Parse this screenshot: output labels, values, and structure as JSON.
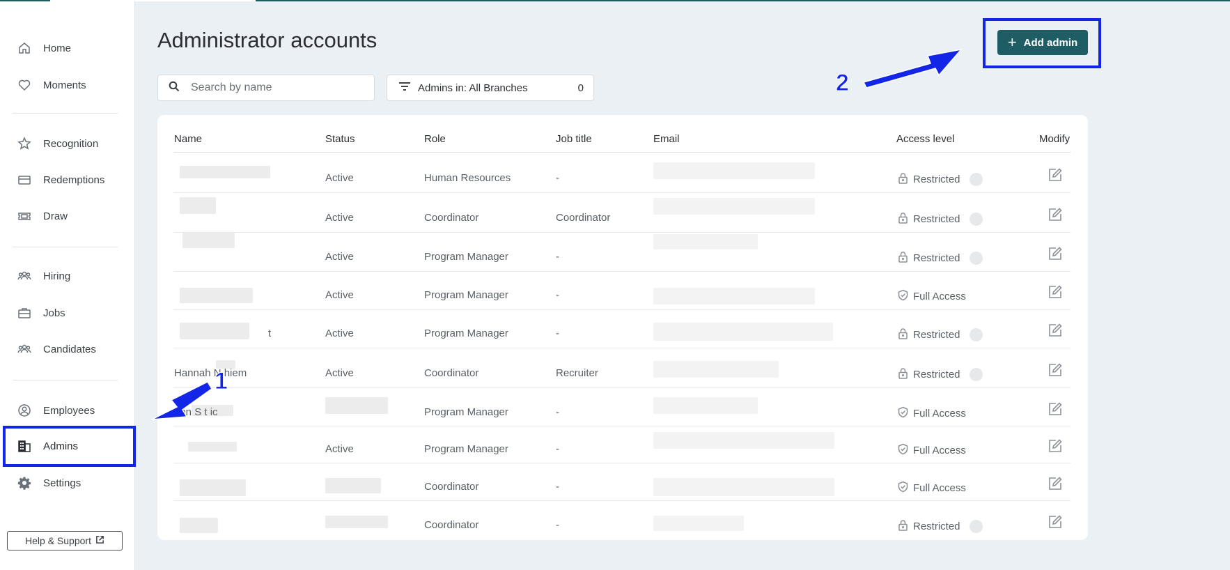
{
  "sidebar": {
    "items": [
      {
        "label": "Home",
        "icon": "home-icon"
      },
      {
        "label": "Moments",
        "icon": "heart-icon"
      },
      {
        "label": "Recognition",
        "icon": "star-icon"
      },
      {
        "label": "Redemptions",
        "icon": "card-icon"
      },
      {
        "label": "Draw",
        "icon": "ticket-icon"
      },
      {
        "label": "Hiring",
        "icon": "people-icon"
      },
      {
        "label": "Jobs",
        "icon": "briefcase-icon"
      },
      {
        "label": "Candidates",
        "icon": "people-icon"
      },
      {
        "label": "Employees",
        "icon": "user-circle-icon"
      },
      {
        "label": "Admins",
        "icon": "building-icon"
      },
      {
        "label": "Settings",
        "icon": "gear-icon"
      }
    ],
    "help_label": "Help & Support"
  },
  "annotations": {
    "step1": "1",
    "step2": "2"
  },
  "main": {
    "title": "Administrator accounts",
    "add_button": "Add admin",
    "search_placeholder": "Search by name",
    "filter_label": "Admins in: All Branches",
    "filter_count": "0"
  },
  "table": {
    "columns": [
      "Name",
      "Status",
      "Role",
      "Job title",
      "Email",
      "Access level",
      "Modify"
    ],
    "rows": [
      {
        "name": "",
        "status": "Active",
        "role": "Human Resources",
        "job_title": "-",
        "access": "Restricted"
      },
      {
        "name": "",
        "status": "Active",
        "role": "Coordinator",
        "job_title": "Coordinator",
        "access": "Restricted"
      },
      {
        "name": "",
        "status": "Active",
        "role": "Program Manager",
        "job_title": "-",
        "access": "Restricted"
      },
      {
        "name": "",
        "status": "Active",
        "role": "Program Manager",
        "job_title": "-",
        "access": "Full Access"
      },
      {
        "name": "t",
        "status": "Active",
        "role": "Program Manager",
        "job_title": "-",
        "access": "Restricted"
      },
      {
        "name": "Hannah N  hiem",
        "status": "Active",
        "role": "Coordinator",
        "job_title": "Recruiter",
        "access": "Restricted"
      },
      {
        "name": "ohn  S  t  ic",
        "status": "",
        "role": "Program Manager",
        "job_title": "-",
        "access": "Full Access"
      },
      {
        "name": "",
        "status": "Active",
        "role": "Program Manager",
        "job_title": "-",
        "access": "Full Access"
      },
      {
        "name": "",
        "status": "",
        "role": "Coordinator",
        "job_title": "-",
        "access": "Full Access"
      },
      {
        "name": "",
        "status": "",
        "role": "Coordinator",
        "job_title": "-",
        "access": "Restricted"
      }
    ]
  },
  "colors": {
    "accent": "#1e5d63",
    "annotation": "#1326e8",
    "background": "#eaf0f4"
  }
}
